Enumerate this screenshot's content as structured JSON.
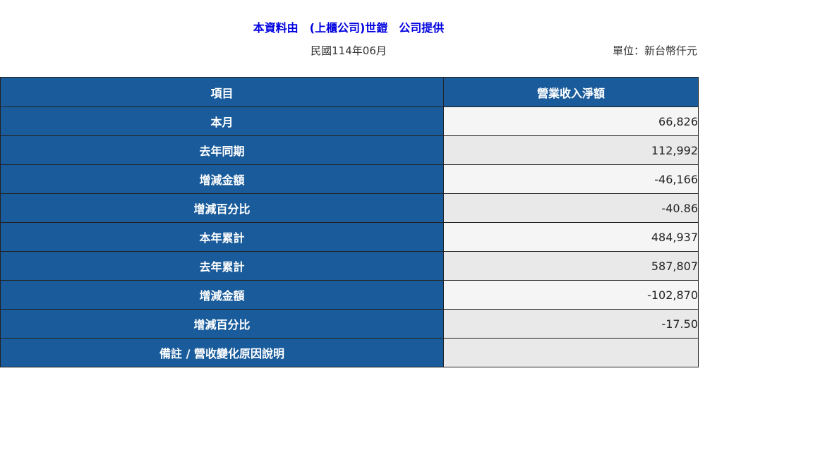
{
  "header": {
    "source_text": "本資料由　(上櫃公司)世鎧　公司提供",
    "period": "民國114年06月",
    "unit": "單位：新台幣仟元"
  },
  "table": {
    "columns": [
      "項目",
      "營業收入淨額"
    ],
    "rows": [
      {
        "label": "本月",
        "value": "66,826"
      },
      {
        "label": "去年同期",
        "value": "112,992"
      },
      {
        "label": "增減金額",
        "value": "-46,166"
      },
      {
        "label": "增減百分比",
        "value": "-40.86"
      },
      {
        "label": "本年累計",
        "value": "484,937"
      },
      {
        "label": "去年累計",
        "value": "587,807"
      },
      {
        "label": "增減金額",
        "value": "-102,870"
      },
      {
        "label": "增減百分比",
        "value": "-17.50"
      },
      {
        "label": "備註 / 營收變化原因說明",
        "value": ""
      }
    ]
  },
  "colors": {
    "header_bg": "#1a5c9b",
    "source_text": "#0000e0",
    "row_light": "#f5f5f5",
    "row_dark": "#e9e9e9"
  }
}
